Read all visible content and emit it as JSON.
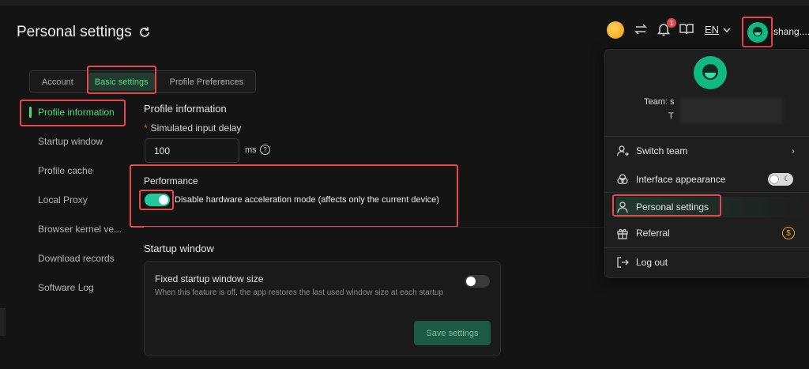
{
  "header": {
    "title": "Personal settings",
    "notification_count": "1",
    "language": "EN",
    "username": "shang...."
  },
  "tabs": [
    {
      "label": "Account"
    },
    {
      "label": "Basic settings"
    },
    {
      "label": "Profile Preferences"
    }
  ],
  "left_nav": [
    {
      "label": "Profile information"
    },
    {
      "label": "Startup window"
    },
    {
      "label": "Profile cache"
    },
    {
      "label": "Local Proxy"
    },
    {
      "label": "Browser kernel ve..."
    },
    {
      "label": "Download records"
    },
    {
      "label": "Software Log"
    }
  ],
  "profile_info": {
    "title": "Profile information",
    "delay_label": "Simulated input delay",
    "delay_value": "100",
    "delay_unit": "ms"
  },
  "performance": {
    "title": "Performance",
    "toggle_label": "Disable hardware acceleration mode (affects only the current device)",
    "enabled": true
  },
  "startup_window": {
    "title": "Startup window",
    "card_title": "Fixed startup window size",
    "card_desc": "When this feature is off, the app restores the last used window size at each startup",
    "enabled": false,
    "save_label": "Save settings"
  },
  "account_menu": {
    "team_line1": "Team: s",
    "team_line2": "T",
    "items": [
      {
        "label": "Switch team"
      },
      {
        "label": "Interface appearance"
      },
      {
        "label": "Personal settings"
      },
      {
        "label": "Referral"
      },
      {
        "label": "Log out"
      }
    ],
    "referral_symbol": "$"
  },
  "colors": {
    "accent": "#4ade80",
    "toggle_on": "#22c7a0",
    "highlight_box": "#e5484d"
  }
}
